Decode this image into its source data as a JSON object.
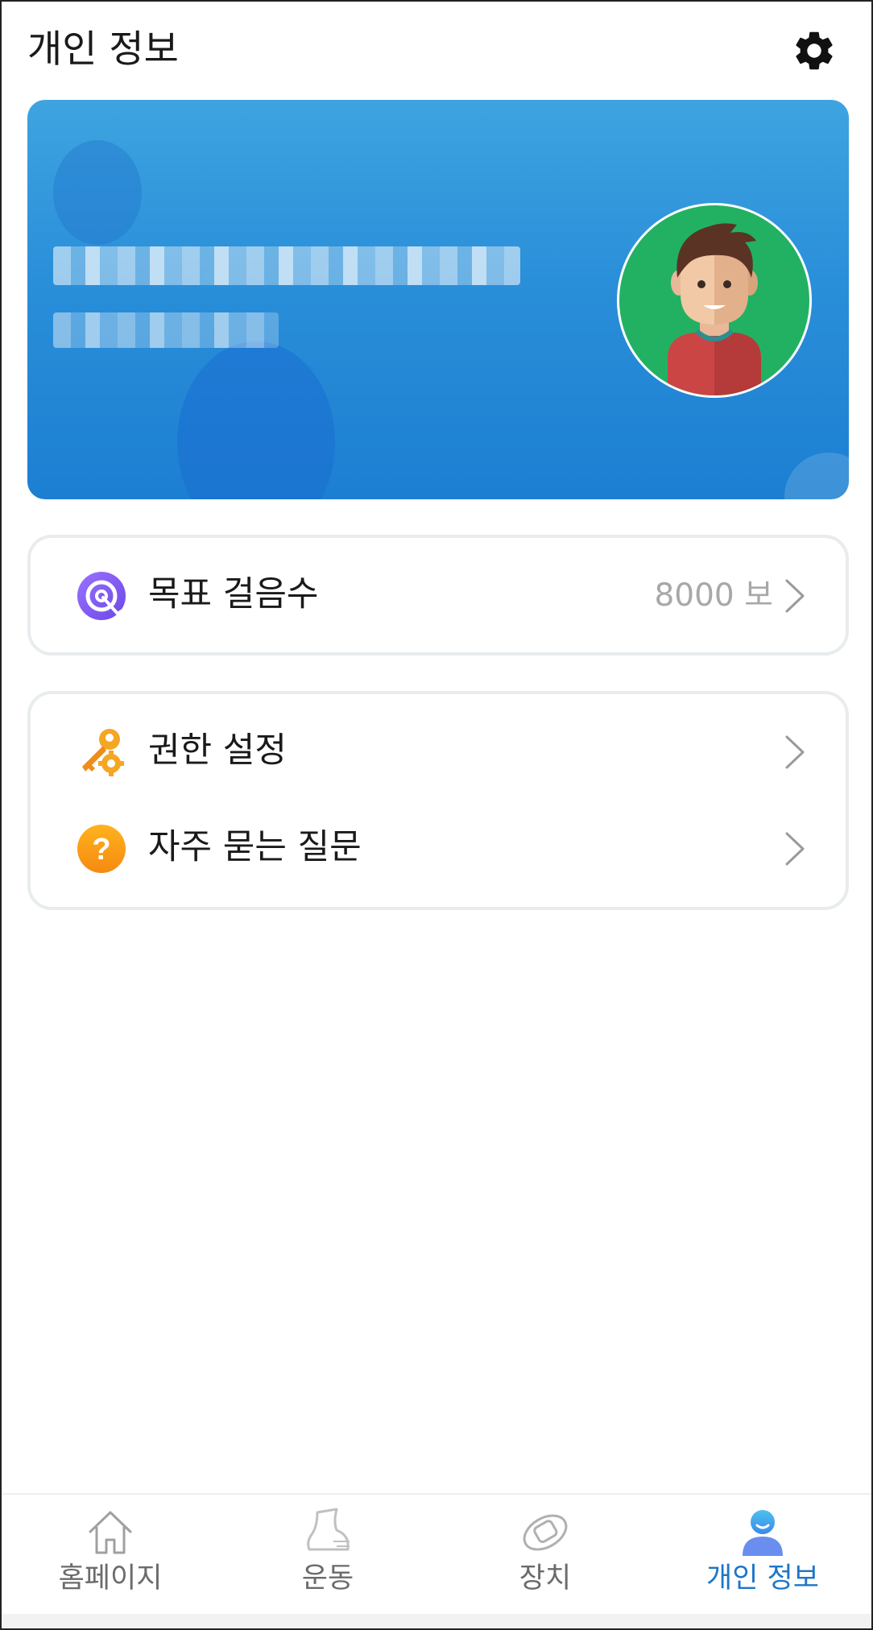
{
  "header": {
    "title": "개인 정보",
    "settings_icon": "gear-icon"
  },
  "profile": {
    "name_obscured": true,
    "avatar_icon": "user-avatar-icon"
  },
  "goal_card": {
    "label": "목표 걸음수",
    "value": "8000 보",
    "icon": "target-icon"
  },
  "menu": {
    "items": [
      {
        "label": "권한 설정",
        "icon": "key-gear-icon"
      },
      {
        "label": "자주 묻는 질문",
        "icon": "question-icon"
      }
    ]
  },
  "bottom_nav": {
    "items": [
      {
        "label": "홈페이지",
        "icon": "home-icon",
        "active": false
      },
      {
        "label": "운동",
        "icon": "shoe-icon",
        "active": false
      },
      {
        "label": "장치",
        "icon": "band-icon",
        "active": false
      },
      {
        "label": "개인 정보",
        "icon": "profile-icon",
        "active": true
      }
    ]
  },
  "colors": {
    "accent": "#1c76c8",
    "card_gradient_top": "#3ea4e0",
    "card_gradient_bottom": "#1c7fd2",
    "avatar_bg": "#22b163",
    "inactive_text": "#6b6b6b",
    "value_text": "#a8a8a8"
  }
}
